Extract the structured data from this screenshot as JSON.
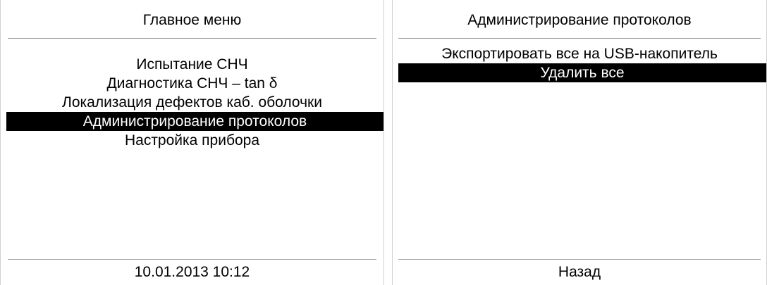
{
  "left_panel": {
    "title": "Главное меню",
    "items": [
      "Испытание СНЧ",
      "Диагностика СНЧ – tan δ",
      "Локализация дефектов каб. оболочки",
      "Администрирование протоколов",
      "Настройка прибора"
    ],
    "selected_index": 3,
    "footer": "10.01.2013 10:12"
  },
  "right_panel": {
    "title": "Администрирование протоколов",
    "items": [
      "Экспортировать все на USB-накопитель",
      "Удалить все"
    ],
    "selected_index": 1,
    "footer": "Назад"
  },
  "colors": {
    "background": "#ffffff",
    "text": "#000000",
    "selection_background": "#000000",
    "selection_text": "#ffffff",
    "divider": "#9a9a9a"
  }
}
